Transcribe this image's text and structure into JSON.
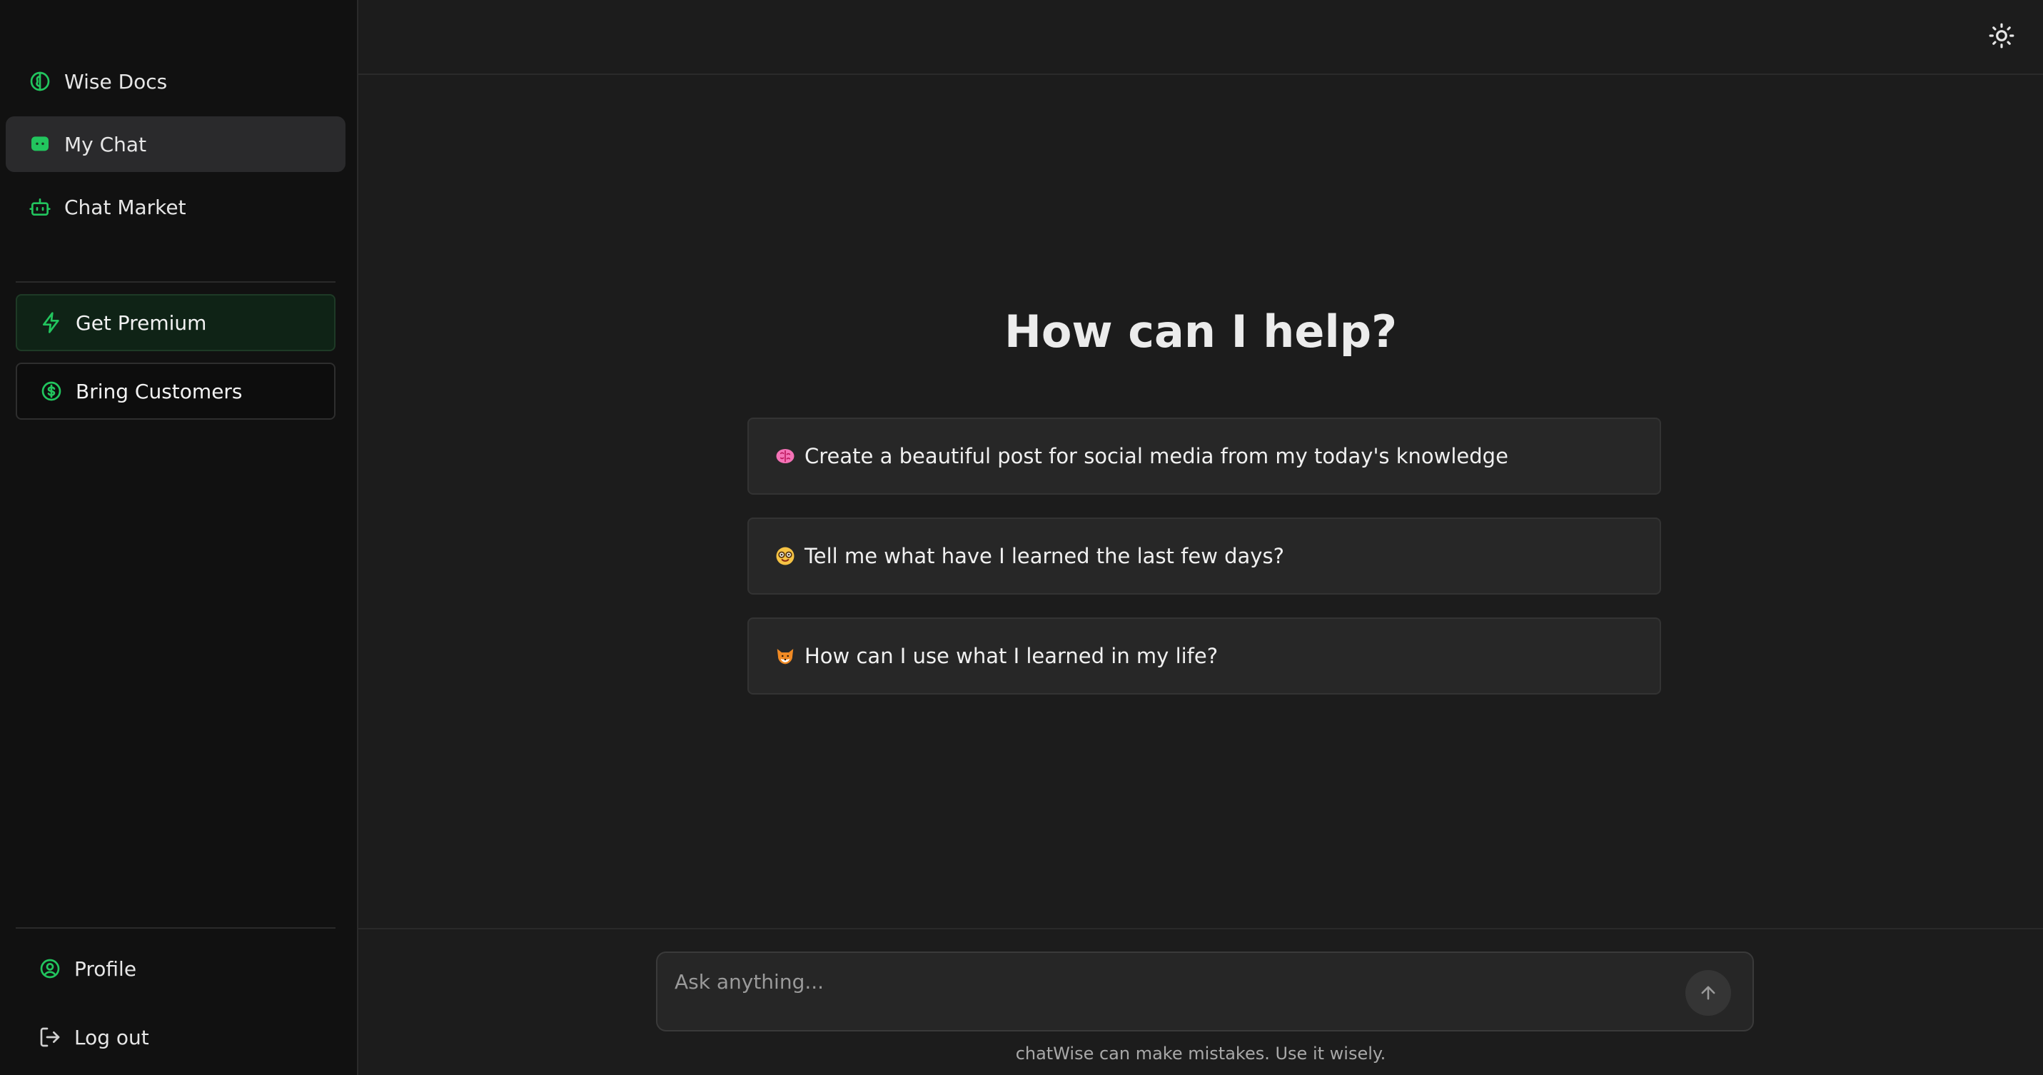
{
  "sidebar": {
    "nav": [
      {
        "label": "Wise Docs",
        "icon": "brain-icon"
      },
      {
        "label": "My Chat",
        "icon": "chat-icon",
        "active": true
      },
      {
        "label": "Chat Market",
        "icon": "bot-icon"
      }
    ],
    "premium_label": "Get Premium",
    "customers_label": "Bring Customers",
    "profile_label": "Profile",
    "logout_label": "Log out"
  },
  "header": {
    "theme_toggle_icon": "sun-icon"
  },
  "main": {
    "heading": "How can I help?",
    "suggestions": [
      {
        "emoji": "brain-emoji",
        "text": "Create a beautiful post for social media from my today's knowledge"
      },
      {
        "emoji": "nerd-face-emoji",
        "text": "Tell me what have I learned the last few days?"
      },
      {
        "emoji": "fox-emoji",
        "text": "How can I use what I learned in my life?"
      }
    ]
  },
  "composer": {
    "placeholder": "Ask anything...",
    "value": ""
  },
  "footer": {
    "disclaimer": "chatWise can make mistakes. Use it wisely."
  },
  "colors": {
    "accent": "#22c55e",
    "sidebar_bg": "#111111",
    "main_bg": "#1c1c1c",
    "card_bg": "#272727"
  }
}
